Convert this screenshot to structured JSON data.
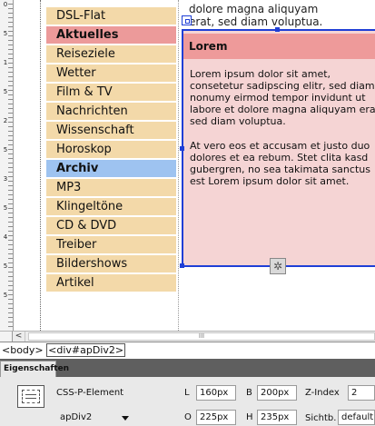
{
  "ruler": {
    "marks": [
      "0",
      "5",
      "1",
      "5",
      "2",
      "5",
      "3",
      "5",
      "4",
      "5",
      "5"
    ]
  },
  "nav": {
    "items": [
      {
        "label": "DSL-Flat"
      },
      {
        "label": "Aktuelles"
      },
      {
        "label": "Reiseziele"
      },
      {
        "label": "Wetter"
      },
      {
        "label": "Film & TV"
      },
      {
        "label": "Nachrichten"
      },
      {
        "label": "Wissenschaft"
      },
      {
        "label": "Horoskop"
      },
      {
        "label": "Archiv"
      },
      {
        "label": "MP3"
      },
      {
        "label": "Klingeltöne"
      },
      {
        "label": "CD & DVD"
      },
      {
        "label": "Treiber"
      },
      {
        "label": "Bildershows"
      },
      {
        "label": "Artikel"
      }
    ],
    "active_index": 1,
    "current_index": 8
  },
  "background_text": {
    "line1": "dolore magna aliquyam",
    "line2": "erat, sed diam voluptua."
  },
  "apdiv": {
    "header": "Lorem",
    "paragraph1": "Lorem ipsum dolor sit amet, consetetur sadipscing elitr, sed diam nonumy eirmod tempor invidunt ut labore et dolore magna aliquyam erat, sed diam voluptua.",
    "paragraph2": "At vero eos et accusam et justo duo dolores et ea rebum. Stet clita kasd gubergren, no sea takimata sanctus est Lorem ipsum dolor sit amet."
  },
  "scrollbar": {
    "left_arrow": "<",
    "thumb_grip": "III"
  },
  "tag_selector": {
    "body_tag": "<body>",
    "div_tag": "<div#apDiv2>"
  },
  "properties": {
    "tab_label": "Eigenschaften",
    "element_type": "CSS-P-Element",
    "element_id": "apDiv2",
    "L_label": "L",
    "L_value": "160px",
    "T_label": "O",
    "T_value": "225px",
    "W_label": "B",
    "W_value": "200px",
    "H_label": "H",
    "H_value": "235px",
    "z_label": "Z-Index",
    "z_value": "2",
    "vis_label": "Sichtb.",
    "vis_value": "default"
  },
  "colors": {
    "nav_bg": "#f3d9a9",
    "nav_active": "#ec9a9a",
    "nav_current": "#9ec3f0",
    "apdiv_bg": "#f5d4d4",
    "apdiv_header": "#ee9a9a",
    "selection": "#1f3fd6"
  }
}
